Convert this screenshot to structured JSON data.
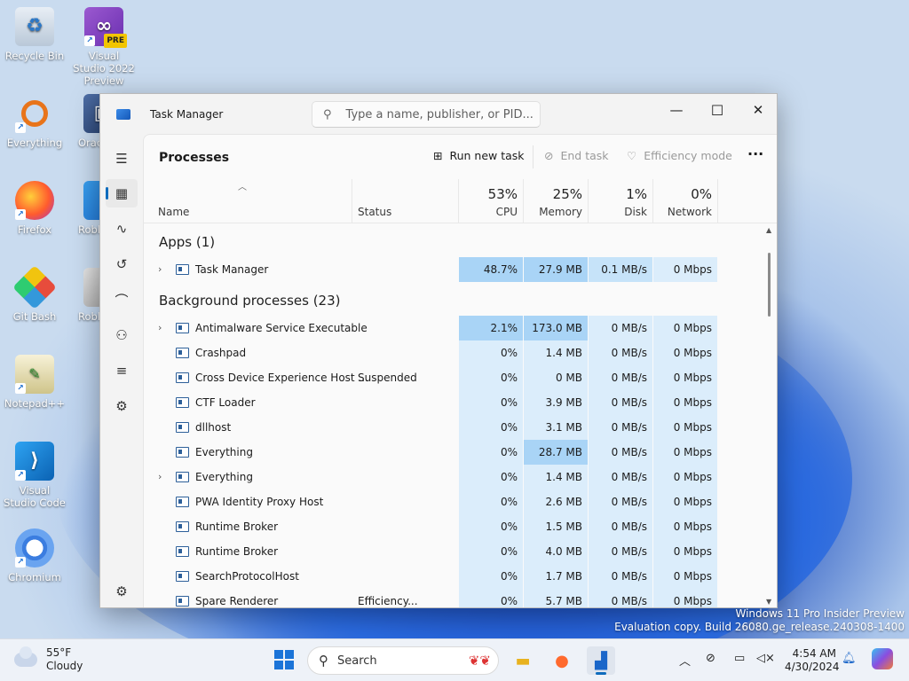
{
  "desktop": {
    "icons": [
      {
        "label": "Recycle Bin"
      },
      {
        "label": "Visual Studio 2022 Preview",
        "badge": "PRE"
      },
      {
        "label": "Everything"
      },
      {
        "label": "Oracle VirtualBox",
        "visible": "Orac Virtu"
      },
      {
        "label": "Firefox"
      },
      {
        "label": "Roblox",
        "visible": "Roblo"
      },
      {
        "label": "Git Bash"
      },
      {
        "label": "Roblox Studio",
        "visible": "Roblo"
      },
      {
        "label": "Notepad++"
      },
      {
        "label": "Visual Studio Code"
      },
      {
        "label": "Chromium"
      }
    ],
    "watermark": {
      "line1": "Windows 11 Pro Insider Preview",
      "line2": "Evaluation copy. Build 26080.ge_release.240308-1400"
    }
  },
  "window": {
    "title": "Task Manager",
    "search_placeholder": "Type a name, publisher, or PID...",
    "controls": {
      "minimize": "—",
      "maximize": "☐",
      "close": "✕"
    },
    "page_title": "Processes",
    "toolbar": {
      "run_new_task": "Run new task",
      "end_task": "End task",
      "efficiency_mode": "Efficiency mode",
      "more": "···"
    },
    "sidebar": [
      "menu-icon",
      "processes-icon",
      "performance-icon",
      "app-history-icon",
      "startup-apps-icon",
      "users-icon",
      "details-icon",
      "services-icon",
      "settings-icon"
    ],
    "columns": {
      "name": "Name",
      "status": "Status",
      "cpu": {
        "pct": "53%",
        "label": "CPU"
      },
      "memory": {
        "pct": "25%",
        "label": "Memory"
      },
      "disk": {
        "pct": "1%",
        "label": "Disk"
      },
      "network": {
        "pct": "0%",
        "label": "Network"
      }
    },
    "groups": {
      "apps": "Apps (1)",
      "background": "Background processes (23)"
    },
    "apps": [
      {
        "name": "Task Manager",
        "status": "",
        "cpu": "48.7%",
        "memory": "27.9 MB",
        "disk": "0.1 MB/s",
        "network": "0 Mbps"
      }
    ],
    "background": [
      {
        "name": "Antimalware Service Executable",
        "status": "",
        "cpu": "2.1%",
        "memory": "173.0 MB",
        "disk": "0 MB/s",
        "network": "0 Mbps"
      },
      {
        "name": "Crashpad",
        "status": "",
        "cpu": "0%",
        "memory": "1.4 MB",
        "disk": "0 MB/s",
        "network": "0 Mbps"
      },
      {
        "name": "Cross Device Experience Host ...",
        "status": "Suspended",
        "cpu": "0%",
        "memory": "0 MB",
        "disk": "0 MB/s",
        "network": "0 Mbps"
      },
      {
        "name": "CTF Loader",
        "status": "",
        "cpu": "0%",
        "memory": "3.9 MB",
        "disk": "0 MB/s",
        "network": "0 Mbps"
      },
      {
        "name": "dllhost",
        "status": "",
        "cpu": "0%",
        "memory": "3.1 MB",
        "disk": "0 MB/s",
        "network": "0 Mbps"
      },
      {
        "name": "Everything",
        "status": "",
        "cpu": "0%",
        "memory": "28.7 MB",
        "disk": "0 MB/s",
        "network": "0 Mbps"
      },
      {
        "name": "Everything",
        "status": "",
        "cpu": "0%",
        "memory": "1.4 MB",
        "disk": "0 MB/s",
        "network": "0 Mbps"
      },
      {
        "name": "PWA Identity Proxy Host",
        "status": "",
        "cpu": "0%",
        "memory": "2.6 MB",
        "disk": "0 MB/s",
        "network": "0 Mbps"
      },
      {
        "name": "Runtime Broker",
        "status": "",
        "cpu": "0%",
        "memory": "1.5 MB",
        "disk": "0 MB/s",
        "network": "0 Mbps"
      },
      {
        "name": "Runtime Broker",
        "status": "",
        "cpu": "0%",
        "memory": "4.0 MB",
        "disk": "0 MB/s",
        "network": "0 Mbps"
      },
      {
        "name": "SearchProtocolHost",
        "status": "",
        "cpu": "0%",
        "memory": "1.7 MB",
        "disk": "0 MB/s",
        "network": "0 Mbps"
      },
      {
        "name": "Spare Renderer",
        "status": "Efficiency...",
        "cpu": "0%",
        "memory": "5.7 MB",
        "disk": "0 MB/s",
        "network": "0 Mbps"
      }
    ]
  },
  "taskbar": {
    "weather": {
      "temp": "55°F",
      "condition": "Cloudy"
    },
    "search_label": "Search",
    "clock": {
      "time": "4:54 AM",
      "date": "4/30/2024"
    }
  },
  "colors": {
    "accent": "#0f6cbd",
    "heat_high": "#a9d4f6",
    "heat_low": "#dbedfb"
  }
}
